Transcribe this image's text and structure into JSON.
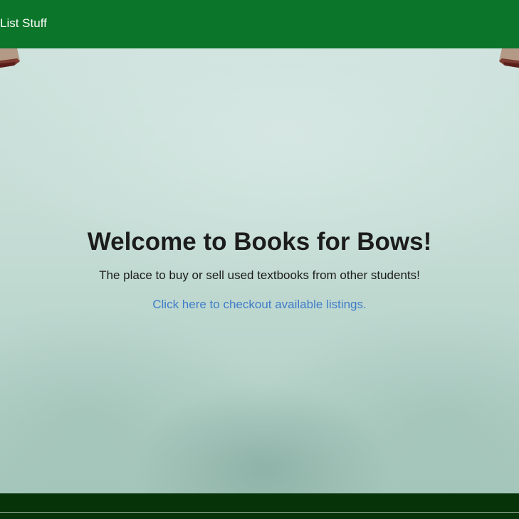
{
  "navbar": {
    "brand_label": "List Stuff",
    "background_color": "#0b7529"
  },
  "hero": {
    "title": "Welcome to Books for Bows!",
    "subtitle": "The place to buy or sell used textbooks from other students!",
    "link_label": "Click here to checkout available listings.",
    "link_color": "#3f7cc7"
  },
  "footer": {
    "background_color": "#063307"
  }
}
